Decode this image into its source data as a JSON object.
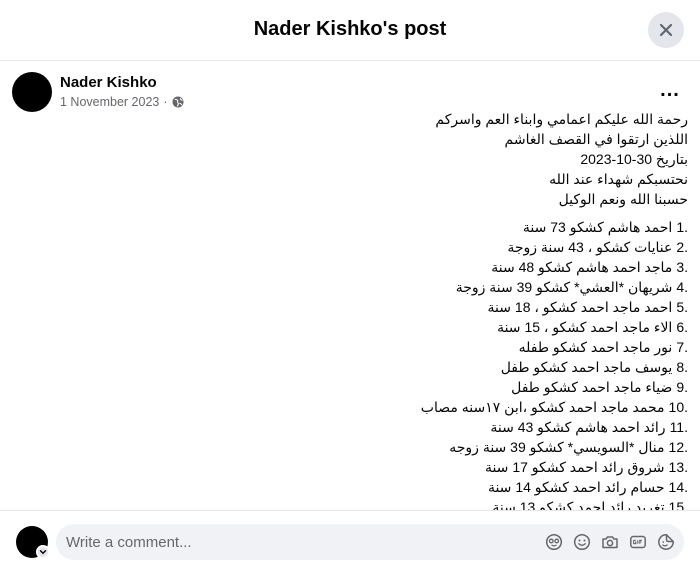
{
  "header": {
    "title": "Nader Kishko's post"
  },
  "post": {
    "author": "Nader Kishko",
    "date": "1 November 2023",
    "separator": "·",
    "more_label": "...",
    "intro_lines": [
      "رحمة الله عليكم اعمامي وابناء العم واسركم",
      "اللذين ارتقوا في القصف الغاشم",
      "بتاريخ 30-10-2023",
      "نحتسبكم شهداء عند الله",
      "حسبنا الله ونعم الوكيل"
    ],
    "list": [
      {
        "num": "1.",
        "text": "احمد هاشم كشكو  73 سنة"
      },
      {
        "num": "2.",
        "text": "عنايات كشكو     ،  43 سنة زوجة"
      },
      {
        "num": "3.",
        "text": "ماجد احمد هاشم كشكو  48 سنة"
      },
      {
        "num": "4.",
        "text": "شريهان *العشي* كشكو 39 سنة زوجة"
      },
      {
        "num": "5.",
        "text": "احمد ماجد احمد كشكو   ، 18 سنة"
      },
      {
        "num": "6.",
        "text": "الاء ماجد احمد كشكو  ،  15 سنة"
      },
      {
        "num": "7.",
        "text": "نور ماجد احمد كشكو    طفله"
      },
      {
        "num": "8.",
        "text": "يوسف ماجد احمد كشكو  طفل"
      },
      {
        "num": "9.",
        "text": "ضياء ماجد احمد كشكو طفل"
      },
      {
        "num": "10.",
        "text": "محمد ماجد احمد كشكو ،ابن ١٧سنه مصاب"
      },
      {
        "num": "11.",
        "text": "رائد احمد هاشم كشكو 43 سنة"
      },
      {
        "num": "12.",
        "text": "منال *السويسي* كشكو 39 سنة زوجه"
      },
      {
        "num": "13.",
        "text": "شروق رائد  احمد كشكو 17 سنة"
      },
      {
        "num": "14.",
        "text": "حسام رائد احمد كشكو  14 سنة"
      },
      {
        "num": "15.",
        "text": "تغريد رائد احمد كشكو  13 سنة"
      }
    ]
  },
  "footer": {
    "comment_placeholder": "Write a comment...",
    "icons": [
      "avatar-sticker-icon",
      "emoji-icon",
      "camera-icon",
      "gif-icon",
      "sticker-icon"
    ]
  },
  "colors": {
    "muted": "#65676b",
    "divider": "#e4e6eb",
    "input_bg": "#f0f2f5"
  }
}
